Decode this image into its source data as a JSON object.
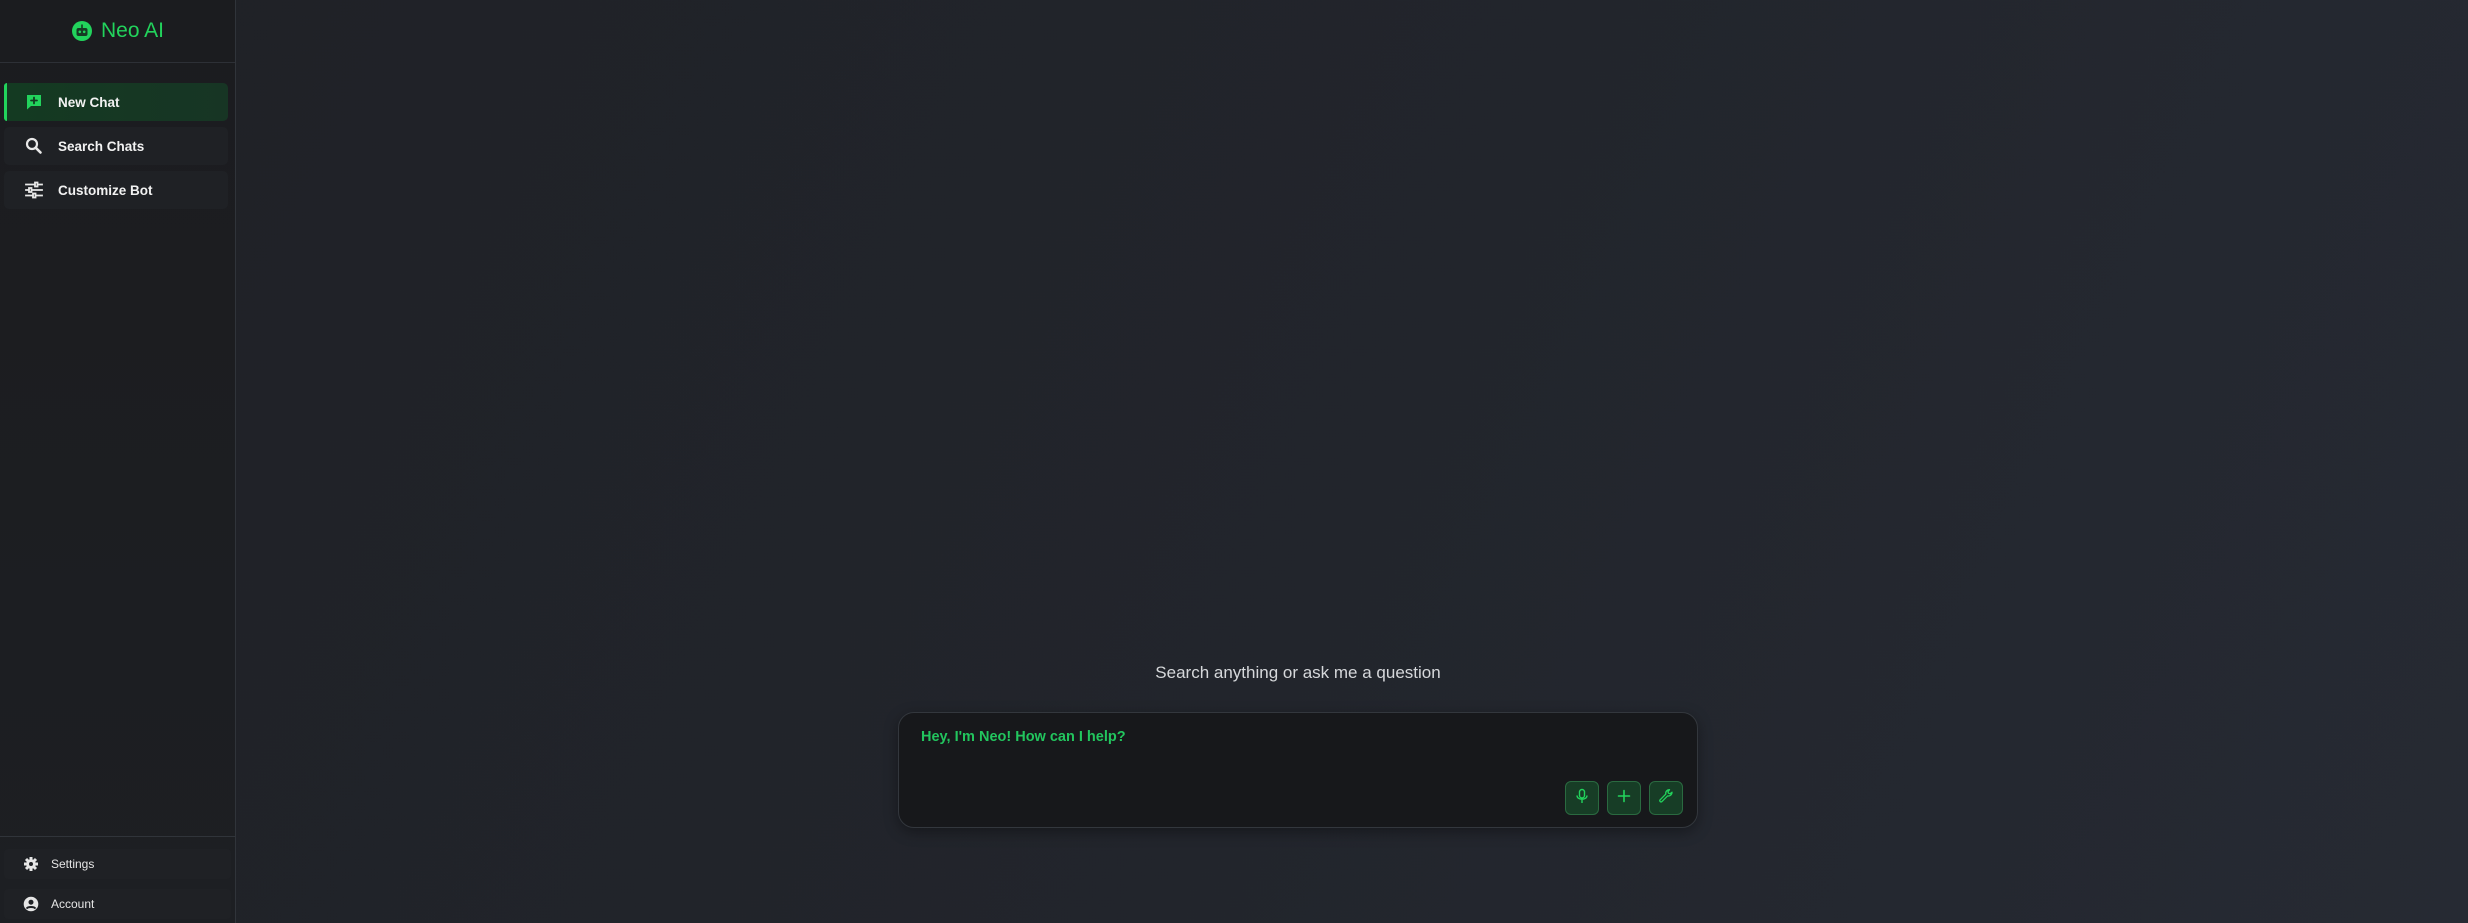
{
  "app": {
    "name": "Neo AI",
    "accent_color": "#22d35c"
  },
  "sidebar": {
    "brand_icon": "robot-icon",
    "items": [
      {
        "label": "New Chat",
        "icon": "new-chat-icon",
        "active": true
      },
      {
        "label": "Search Chats",
        "icon": "search-icon",
        "active": false
      },
      {
        "label": "Customize Bot",
        "icon": "sliders-icon",
        "active": false
      }
    ],
    "bottom": [
      {
        "label": "Settings",
        "icon": "gear-icon"
      },
      {
        "label": "Account",
        "icon": "account-icon"
      }
    ]
  },
  "main": {
    "heading": "Search anything or ask me a question",
    "composer": {
      "placeholder": "Hey, I'm Neo! How can I help?",
      "value": "",
      "tools": [
        {
          "name": "microphone",
          "icon": "microphone-icon"
        },
        {
          "name": "add",
          "icon": "plus-icon"
        },
        {
          "name": "tools",
          "icon": "wrench-icon"
        }
      ]
    }
  }
}
